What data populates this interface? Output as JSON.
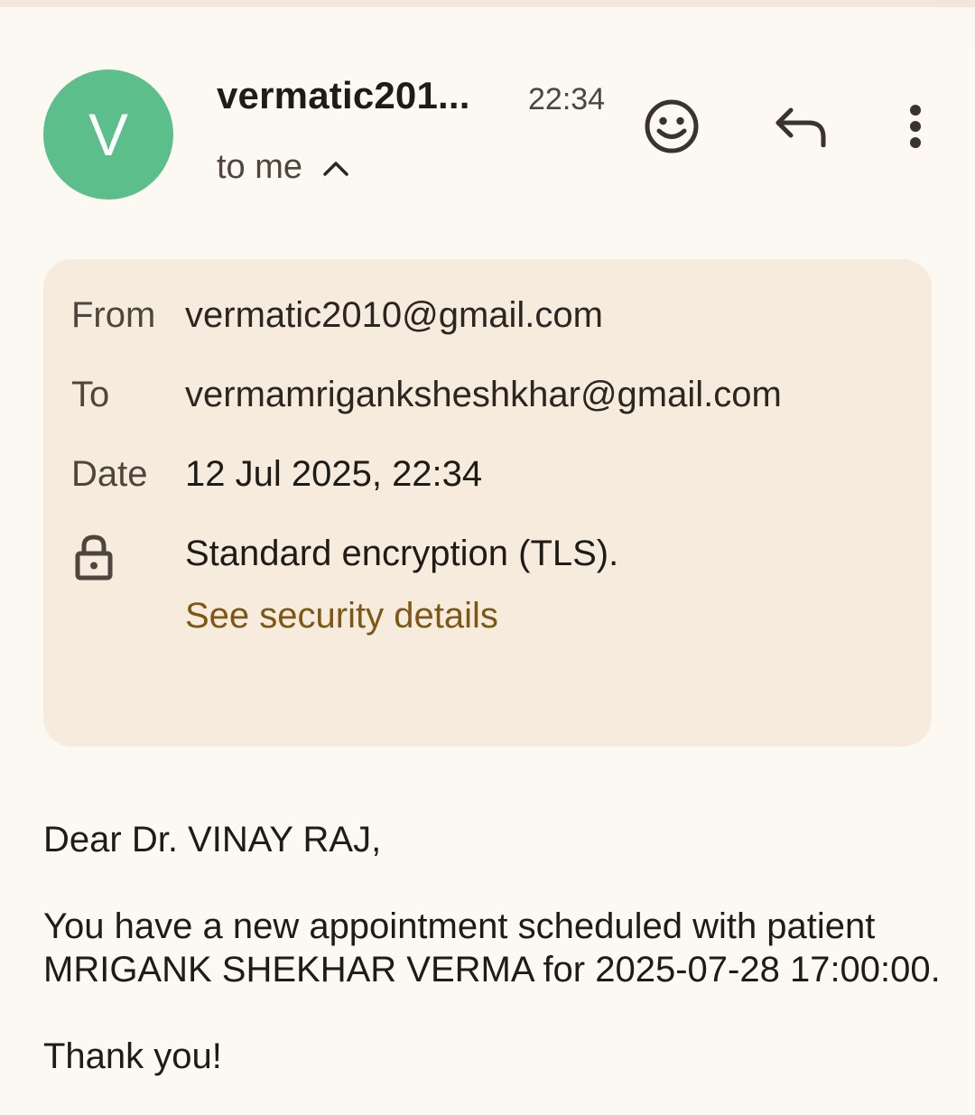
{
  "header": {
    "avatar_letter": "V",
    "sender_name": "vermatic201...",
    "time": "22:34",
    "recipient_summary": "to me",
    "icons": [
      "add-reaction-icon",
      "reply-icon",
      "more-vert-icon",
      "chevron-up-icon"
    ]
  },
  "details": {
    "from_label": "From",
    "from_value": "vermatic2010@gmail.com",
    "to_label": "To",
    "to_value": "vermamriganksheshkhar@gmail.com",
    "date_label": "Date",
    "date_value": "12 Jul 2025, 22:34",
    "encryption_text": "Standard encryption (TLS).",
    "security_link": "See security details"
  },
  "message": {
    "greeting": "Dear Dr. VINAY RAJ,",
    "line1": "You have a new appointment scheduled with patient",
    "line2": "MRIGANK SHEKHAR VERMA for 2025-07-28 17:00:00.",
    "closing": "Thank you!"
  },
  "colors": {
    "avatar": "#5cbe8a",
    "background": "#fcf8f2",
    "details_panel": "#f7ebde",
    "link": "#7c5814"
  }
}
